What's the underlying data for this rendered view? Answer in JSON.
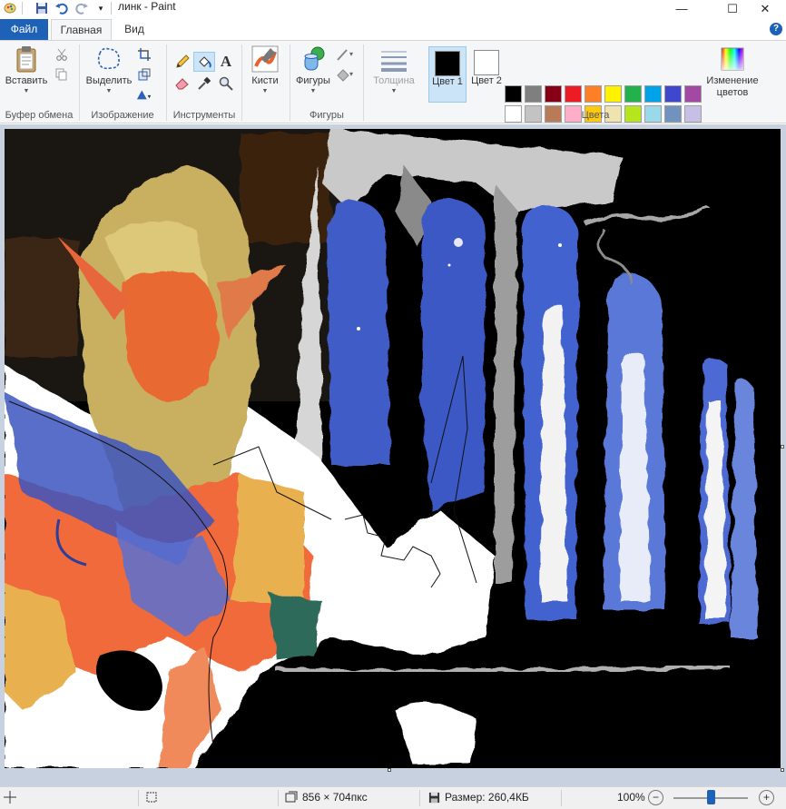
{
  "window": {
    "title": "линк - Paint",
    "minimize": "—",
    "maximize": "☐",
    "close": "✕"
  },
  "tabs": {
    "file": "Файл",
    "home": "Главная",
    "view": "Вид",
    "help": "?"
  },
  "ribbon": {
    "clipboard": {
      "paste": "Вставить",
      "group": "Буфер обмена"
    },
    "image": {
      "select": "Выделить",
      "group": "Изображение"
    },
    "tools": {
      "group": "Инструменты"
    },
    "brushes": {
      "label": "Кисти"
    },
    "shapes": {
      "label": "Фигуры",
      "group": "Фигуры"
    },
    "size": {
      "label": "Толщина"
    },
    "colors": {
      "color1": "Цвет 1",
      "color2": "Цвет 2",
      "edit": "Изменение цветов",
      "group": "Цвета",
      "color1_value": "#000000",
      "color2_value": "#ffffff",
      "palette": [
        "#000000",
        "#7f7f7f",
        "#880015",
        "#ed1c24",
        "#ff7f27",
        "#fff200",
        "#22b14c",
        "#00a2e8",
        "#3f48cc",
        "#a349a4",
        "#ffffff",
        "#c3c3c3",
        "#b97a57",
        "#ffaec9",
        "#ffc90e",
        "#efe4b0",
        "#b5e61d",
        "#99d9ea",
        "#7092be",
        "#c8bfe7",
        "#ffffff",
        "#ffffff",
        "#ffffff",
        "#ffffff",
        "#ffffff",
        "#ffffff",
        "#ffffff",
        "#ffffff",
        "#ffffff",
        "#ffffff"
      ]
    }
  },
  "status": {
    "dimensions": "856 × 704пкс",
    "size": "Размер: 260,4КБ",
    "zoom": "100%",
    "zoom_out": "−",
    "zoom_in": "+",
    "zoom_level": 0.5
  }
}
